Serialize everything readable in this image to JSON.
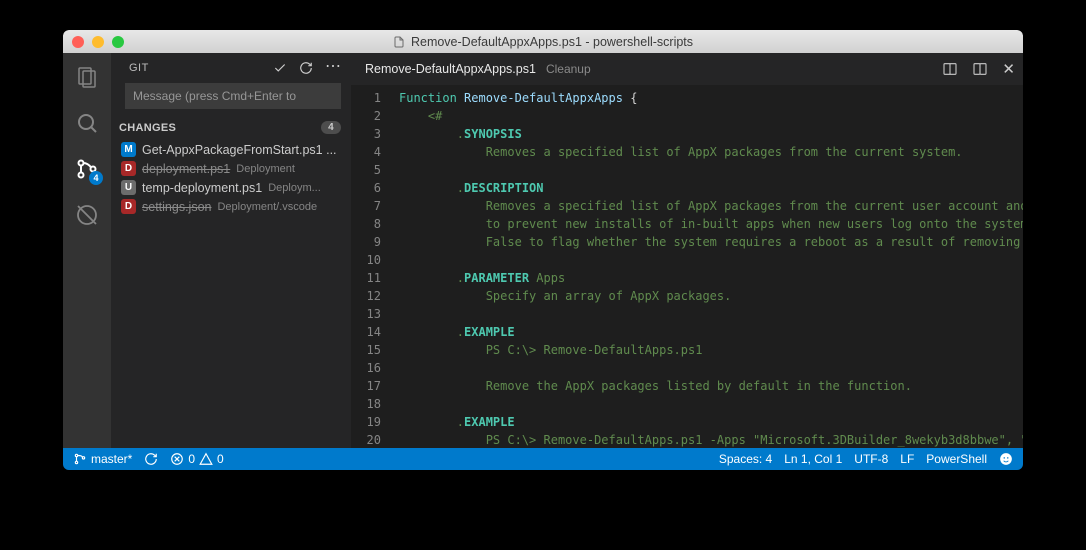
{
  "window": {
    "title": "Remove-DefaultAppxApps.ps1 - powershell-scripts"
  },
  "activity": {
    "scm_badge": "4"
  },
  "scm": {
    "header": "GIT",
    "commit_placeholder": "Message (press Cmd+Enter to",
    "section_label": "CHANGES",
    "change_count": "4",
    "files": [
      {
        "status": "M",
        "name": "Get-AppxPackageFromStart.ps1 ...",
        "dir": "",
        "strike": false
      },
      {
        "status": "D",
        "name": "deployment.ps1",
        "dir": "Deployment",
        "strike": true
      },
      {
        "status": "U",
        "name": "temp-deployment.ps1",
        "dir": "Deploym...",
        "strike": false
      },
      {
        "status": "D",
        "name": "settings.json",
        "dir": "Deployment/.vscode",
        "strike": true
      }
    ]
  },
  "editor": {
    "tab_title": "Remove-DefaultAppxApps.ps1",
    "tab_subtitle": "Cleanup",
    "lines": [
      {
        "n": "1",
        "html": "<span class='k-keyword'>Function</span> <span class='k-funcname'>Remove-DefaultAppxApps</span> <span class='k-brace'>{</span>"
      },
      {
        "n": "2",
        "html": "    <span class='k-comment'>&lt;#</span>"
      },
      {
        "n": "3",
        "html": "        <span class='k-comment'>.</span><span class='k-tag'>SYNOPSIS</span>"
      },
      {
        "n": "4",
        "html": "            <span class='k-comment'>Removes a specified list of AppX packages from the current system.</span>"
      },
      {
        "n": "5",
        "html": ""
      },
      {
        "n": "6",
        "html": "        <span class='k-comment'>.</span><span class='k-tag'>DESCRIPTION</span>"
      },
      {
        "n": "7",
        "html": "            <span class='k-comment'>Removes a specified list of AppX packages from the current user account and</span>"
      },
      {
        "n": "8",
        "html": "            <span class='k-comment'>to prevent new installs of in-built apps when new users log onto the system</span>"
      },
      {
        "n": "9",
        "html": "            <span class='k-comment'>False to flag whether the system requires a reboot as a result of removing </span>"
      },
      {
        "n": "10",
        "html": ""
      },
      {
        "n": "11",
        "html": "        <span class='k-comment'>.</span><span class='k-tag'>PARAMETER</span><span class='k-comment'> Apps</span>"
      },
      {
        "n": "12",
        "html": "            <span class='k-comment'>Specify an array of AppX packages.</span>"
      },
      {
        "n": "13",
        "html": ""
      },
      {
        "n": "14",
        "html": "        <span class='k-comment'>.</span><span class='k-tag'>EXAMPLE</span>"
      },
      {
        "n": "15",
        "html": "            <span class='k-comment'>PS C:\\&gt; Remove-DefaultApps.ps1</span>"
      },
      {
        "n": "16",
        "html": ""
      },
      {
        "n": "17",
        "html": "            <span class='k-comment'>Remove the AppX packages listed by default in the function.</span>"
      },
      {
        "n": "18",
        "html": ""
      },
      {
        "n": "19",
        "html": "        <span class='k-comment'>.</span><span class='k-tag'>EXAMPLE</span>"
      },
      {
        "n": "20",
        "html": "            <span class='k-comment'>PS C:\\&gt; Remove-DefaultApps.ps1 -Apps \"Microsoft.3DBuilder_8wekyb3d8bbwe\", \"</span>"
      }
    ]
  },
  "status": {
    "branch": "master*",
    "errors": "0",
    "warnings": "0",
    "spaces": "Spaces: 4",
    "pos": "Ln 1, Col 1",
    "encoding": "UTF-8",
    "eol": "LF",
    "lang": "PowerShell"
  }
}
